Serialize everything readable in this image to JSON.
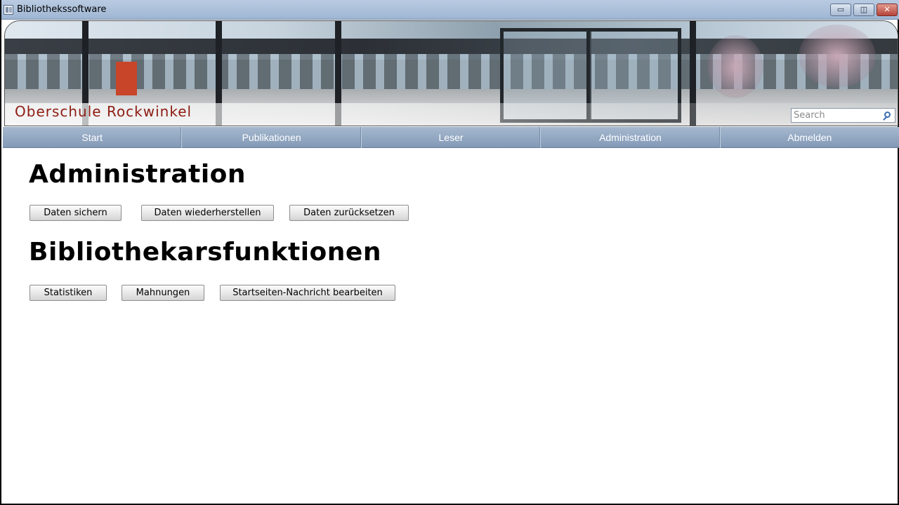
{
  "window": {
    "title": "Bibliothekssoftware",
    "controls": {
      "minimize": "▭",
      "maximize": "◫",
      "close": "✕"
    }
  },
  "banner": {
    "school_name": "Oberschule Rockwinkel",
    "search": {
      "placeholder": "Search",
      "value": ""
    }
  },
  "nav": {
    "items": [
      {
        "label": "Start"
      },
      {
        "label": "Publikationen"
      },
      {
        "label": "Leser"
      },
      {
        "label": "Administration"
      },
      {
        "label": "Abmelden"
      }
    ]
  },
  "main": {
    "admin_heading": "Administration",
    "admin_buttons": [
      {
        "label": "Daten sichern"
      },
      {
        "label": "Daten wiederherstellen"
      },
      {
        "label": "Daten zurücksetzen"
      }
    ],
    "librarian_heading": "Bibliothekarsfunktionen",
    "librarian_buttons": [
      {
        "label": "Statistiken"
      },
      {
        "label": "Mahnungen"
      },
      {
        "label": "Startseiten-Nachricht bearbeiten"
      }
    ]
  },
  "colors": {
    "titlebar": "#a9bdd8",
    "navbar": "#8ea3bf",
    "school_name": "#8e1d13",
    "close_button": "#c0524a"
  }
}
